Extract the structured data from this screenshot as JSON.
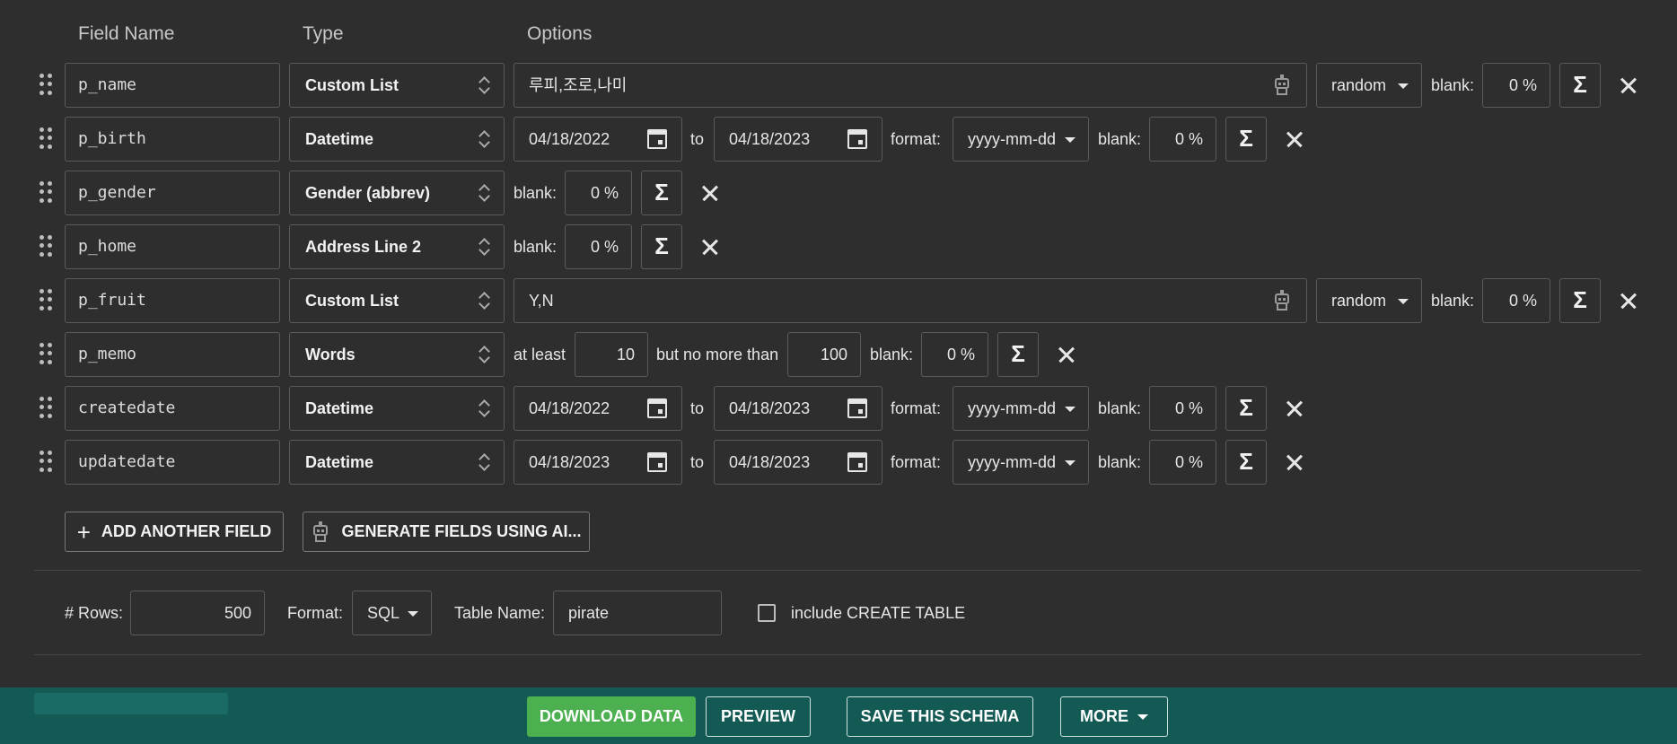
{
  "headers": {
    "field_name": "Field Name",
    "type": "Type",
    "options": "Options"
  },
  "labels": {
    "blank": "blank:",
    "to": "to",
    "format": "format:",
    "at_least": "at least",
    "but_no_more_than": "but no more than",
    "sigma": "Σ"
  },
  "fields": [
    {
      "name": "p_name",
      "type": "Custom List",
      "values": "루피,조로,나미",
      "order": "random",
      "blank": "0 %"
    },
    {
      "name": "p_birth",
      "type": "Datetime",
      "from": "04/18/2022",
      "to": "04/18/2023",
      "format": "yyyy-mm-dd",
      "blank": "0 %"
    },
    {
      "name": "p_gender",
      "type": "Gender (abbrev)",
      "blank": "0 %"
    },
    {
      "name": "p_home",
      "type": "Address Line 2",
      "blank": "0 %"
    },
    {
      "name": "p_fruit",
      "type": "Custom List",
      "values": "Y,N",
      "order": "random",
      "blank": "0 %"
    },
    {
      "name": "p_memo",
      "type": "Words",
      "at_least": "10",
      "no_more_than": "100",
      "blank": "0 %"
    },
    {
      "name": "createdate",
      "type": "Datetime",
      "from": "04/18/2022",
      "to": "04/18/2023",
      "format": "yyyy-mm-dd",
      "blank": "0 %"
    },
    {
      "name": "updatedate",
      "type": "Datetime",
      "from": "04/18/2023",
      "to": "04/18/2023",
      "format": "yyyy-mm-dd",
      "blank": "0 %"
    }
  ],
  "actions": {
    "add_field": "ADD ANOTHER FIELD",
    "generate_ai": "GENERATE FIELDS USING AI..."
  },
  "settings": {
    "rows_label": "# Rows:",
    "rows_value": "500",
    "format_label": "Format:",
    "format_value": "SQL",
    "table_label": "Table Name:",
    "table_value": "pirate",
    "create_table_label": "include CREATE TABLE"
  },
  "footer": {
    "download": "DOWNLOAD DATA",
    "preview": "PREVIEW",
    "save": "SAVE THIS SCHEMA",
    "more": "MORE"
  },
  "colors": {
    "background": "#2e2e2e",
    "footer": "#135954",
    "download": "#4caf50"
  }
}
